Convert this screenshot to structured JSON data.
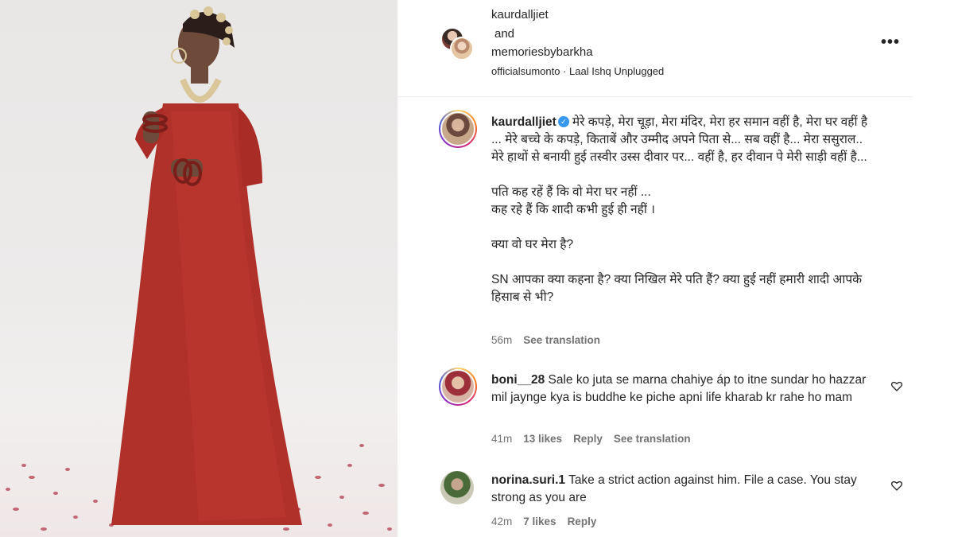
{
  "post": {
    "author_primary": "kaurdalljiet",
    "joiner": "and",
    "author_secondary": "memoriesbybarkha",
    "subline": "officialsumonto · Laal Ishq Unplugged",
    "more_icon": "more-horizontal-icon"
  },
  "caption": {
    "username": "kaurdalljiet",
    "verified_icon": "verified-badge-icon",
    "para1": "मेरे कपड़े, मेरा चूड़ा, मेरा मंदिर, मेरा हर समान वहीं है, मेरा घर वहीं है ... मेरे बच्चे के कपड़े, किताबें और उम्मीद अपने पिता से... सब वहीं है... मेरा ससुराल.. मेरे हाथों से बनायी हुई तस्वीर उस्स दीवार पर... वहीं है, हर दीवान पे मेरी साड़ी वहीं है...",
    "para2_line1": "पति कह रहें हैं कि वो मेरा घर नहीं ...",
    "para2_line2": "कह रहे हैं कि शादी कभी हुई ही नहीं ।",
    "para3": "क्या वो घर मेरा है?",
    "para4": "SN आपका क्या कहना है? क्या निखिल मेरे पति हैं? क्या हुई नहीं हमारी शादी आपके हिसाब से भी?",
    "time": "56m",
    "see_translation": "See translation"
  },
  "comments": [
    {
      "username": "boni__28",
      "text": "Sale ko juta se marna chahiye áp to itne sundar ho hazzar mil jaynge kya is buddhe ke piche apni life kharab kr rahe ho mam",
      "time": "41m",
      "likes": "13 likes",
      "reply": "Reply",
      "see_translation": "See translation",
      "like_icon": "heart-outline-icon"
    },
    {
      "username": "norina.suri.1",
      "text": "Take a strict action against him. File a case. You stay strong as you are",
      "time": "42m",
      "likes": "7 likes",
      "reply": "Reply",
      "like_icon": "heart-outline-icon"
    }
  ],
  "colors": {
    "text": "#262626",
    "secondary": "#737373",
    "verified": "#3897f0",
    "dress": "#b0302a"
  }
}
